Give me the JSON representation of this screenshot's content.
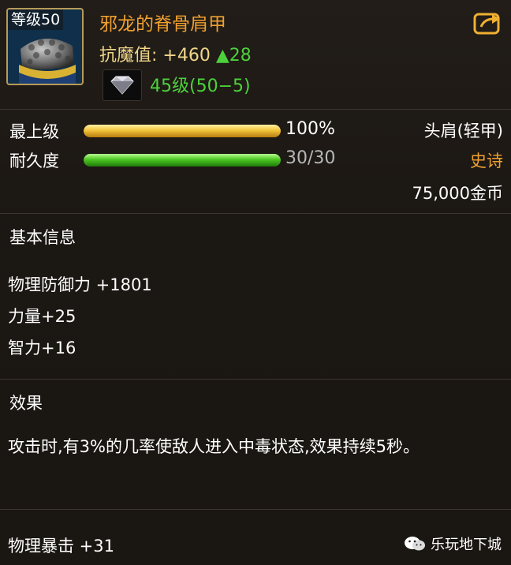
{
  "item": {
    "level_badge": "等级50",
    "name": "邪龙的脊骨肩甲",
    "stat_label": "抗魔值:",
    "stat_value": "+460",
    "stat_delta": "▲28",
    "level_requirement": "45级(50−5)"
  },
  "bars": [
    {
      "label": "最上级",
      "value_text": "100%",
      "fill": 1.0,
      "value_color": "#ffffff"
    },
    {
      "label": "耐久度",
      "value_text": "30/30",
      "fill": 1.0,
      "value_color": "#b8b8b8"
    }
  ],
  "meta": {
    "slot": "头肩(轻甲)",
    "rarity": "史诗",
    "price": "75,000金币"
  },
  "sections": {
    "basic_title": "基本信息",
    "basic_lines": [
      "物理防御力 +1801",
      "力量+25",
      "智力+16"
    ],
    "effect_title": "效果",
    "effect_text": "攻击时,有3%的几率使敌人进入中毒状态,效果持续5秒。",
    "extra_line": "物理暴击 +31"
  },
  "watermark": "乐玩地下城",
  "colors": {
    "name": "#f0a030",
    "gold": "#f0d68a",
    "green": "#4cd13c",
    "rarity": "#f0a030"
  },
  "icons": [
    "share-icon",
    "gem-icon",
    "shoulder-armor-icon",
    "wechat-icon"
  ]
}
